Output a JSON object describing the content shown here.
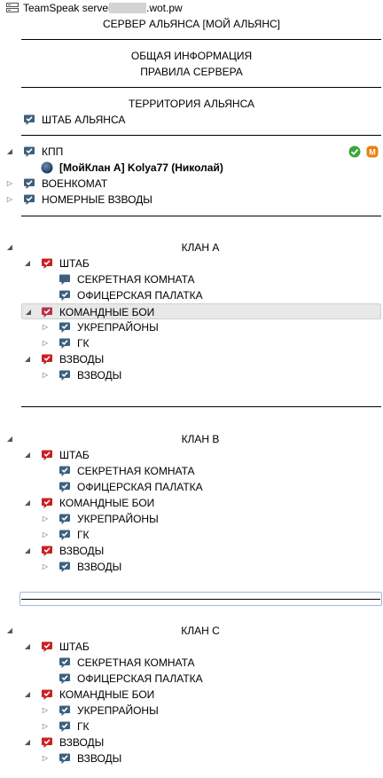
{
  "server": {
    "prefix": "TeamSpeak server",
    "host_suffix": ".wot.pw"
  },
  "headers": {
    "server_name": "СЕРВЕР АЛЬЯНСА [МОЙ АЛЬЯНС]",
    "general_info": "ОБЩАЯ ИНФОРМАЦИЯ",
    "server_rules": "ПРАВИЛА СЕРВЕРА",
    "territory": "ТЕРРИТОРИЯ АЛЬЯНСА",
    "clan_a": "КЛАН А",
    "clan_b": "КЛАН В",
    "clan_c": "КЛАН С"
  },
  "channels": {
    "hq_alliance": "ШТАБ АЛЬЯНСА",
    "kpp": "КПП",
    "voenkomat": "ВОЕНКОМАТ",
    "nomernye": "НОМЕРНЫЕ ВЗВОДЫ",
    "shtab": "ШТАБ",
    "secret_room": "СЕКРЕТНАЯ КОМНАТА",
    "officer_tent": "ОФИЦЕРСКАЯ ПАЛАТКА",
    "team_battles": "КОМАНДНЫЕ БОИ",
    "ukrepraiony": "УКРЕПРАЙОНЫ",
    "gk": "ГК",
    "vzvody": "ВЗВОДЫ"
  },
  "user": {
    "name": "[МойКлан А] Kolya77 (Николай)",
    "badge_letter": "M"
  },
  "colors": {
    "channel_blue": "#3e5f80",
    "channel_red": "#cc1f1f",
    "check_green": "#3ba63b",
    "badge_orange": "#e8820e"
  }
}
